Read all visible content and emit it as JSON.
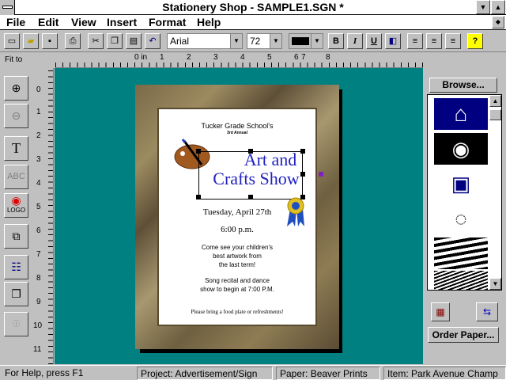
{
  "window": {
    "title": "Stationery Shop - SAMPLE1.SGN *"
  },
  "menu": [
    "File",
    "Edit",
    "View",
    "Insert",
    "Format",
    "Help"
  ],
  "toolbar": {
    "font": "Arial",
    "size": "72",
    "bold": "B",
    "italic": "I",
    "underline": "U",
    "help": "?"
  },
  "ruler": {
    "unit_label": "Fit to",
    "h_ticks": [
      "0 in",
      "1",
      "2",
      "3",
      "4",
      "5",
      "6",
      "7",
      "8"
    ],
    "v_ticks": [
      "0",
      "1",
      "2",
      "3",
      "4",
      "5",
      "6",
      "7",
      "8",
      "9",
      "10",
      "11"
    ]
  },
  "document": {
    "school": "Tucker Grade School's",
    "annual": "3rd Annual",
    "heading_line1": "Art and",
    "heading_line2": "Crafts Show",
    "date": "Tuesday, April 27th",
    "time": "6:00 p.m.",
    "para1_line1": "Come see your children's",
    "para1_line2": "best artwork from",
    "para1_line3": "the last term!",
    "para2_line1": "Song recital and dance",
    "para2_line2": "show to begin at 7:00 P.M.",
    "footer": "Please bring a food plate or refreshments!"
  },
  "right_panel": {
    "browse": "Browse...",
    "order": "Order Paper..."
  },
  "status": {
    "help": "For Help, press F1",
    "project": "Project: Advertisement/Sign",
    "paper": "Paper: Beaver Prints",
    "item": "Item: Park Avenue Champ"
  },
  "colors": {
    "desktop": "#008080",
    "heading": "#2020c0",
    "icon_blue": "#000080"
  }
}
